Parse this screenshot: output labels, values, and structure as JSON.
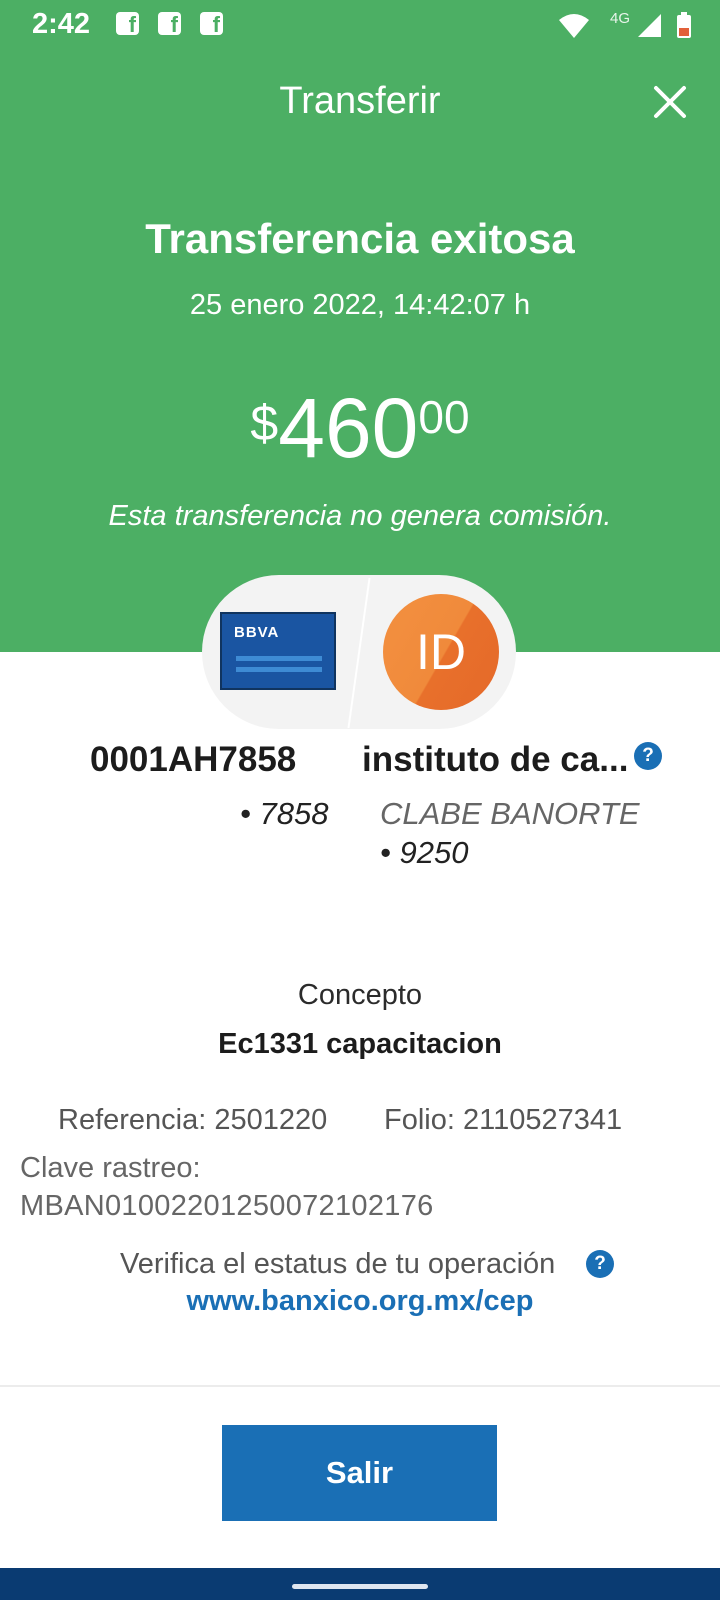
{
  "status_bar": {
    "time": "2:42",
    "network": "4G",
    "notifications": [
      "facebook-icon",
      "facebook-icon",
      "facebook-icon"
    ],
    "icons": [
      "wifi-icon",
      "signal-icon",
      "battery-icon"
    ]
  },
  "header": {
    "title": "Transferir",
    "close_icon": "close-icon"
  },
  "result": {
    "title": "Transferencia exitosa",
    "datetime": "25 enero 2022, 14:42:07 h",
    "amount_currency": "$",
    "amount_integer": "460",
    "amount_decimals": "00",
    "commission_note": "Esta transferencia no genera comisión."
  },
  "origin": {
    "card_brand": "BBVA",
    "account": "0001AH7858",
    "last4": "• 7858"
  },
  "destination": {
    "avatar_initials": "ID",
    "name": "instituto de ca...",
    "bank": "CLABE BANORTE",
    "last4": "• 9250",
    "help_icon": "?"
  },
  "details": {
    "concept_label": "Concepto",
    "concept_value": "Ec1331 capacitacion",
    "reference": "Referencia: 2501220",
    "folio": "Folio: 2110527341",
    "tracking_label": "Clave rastreo:",
    "tracking_value": "MBAN01002201250072102176",
    "verify_text": "Verifica el estatus de tu operación",
    "verify_help_icon": "?",
    "verify_link": "www.banxico.org.mx/cep"
  },
  "actions": {
    "exit_label": "Salir"
  },
  "colors": {
    "header_green": "#4caf64",
    "primary_blue": "#1a6fb5",
    "avatar_orange": "#f08a3b",
    "nav_bar": "#0a3b72"
  }
}
